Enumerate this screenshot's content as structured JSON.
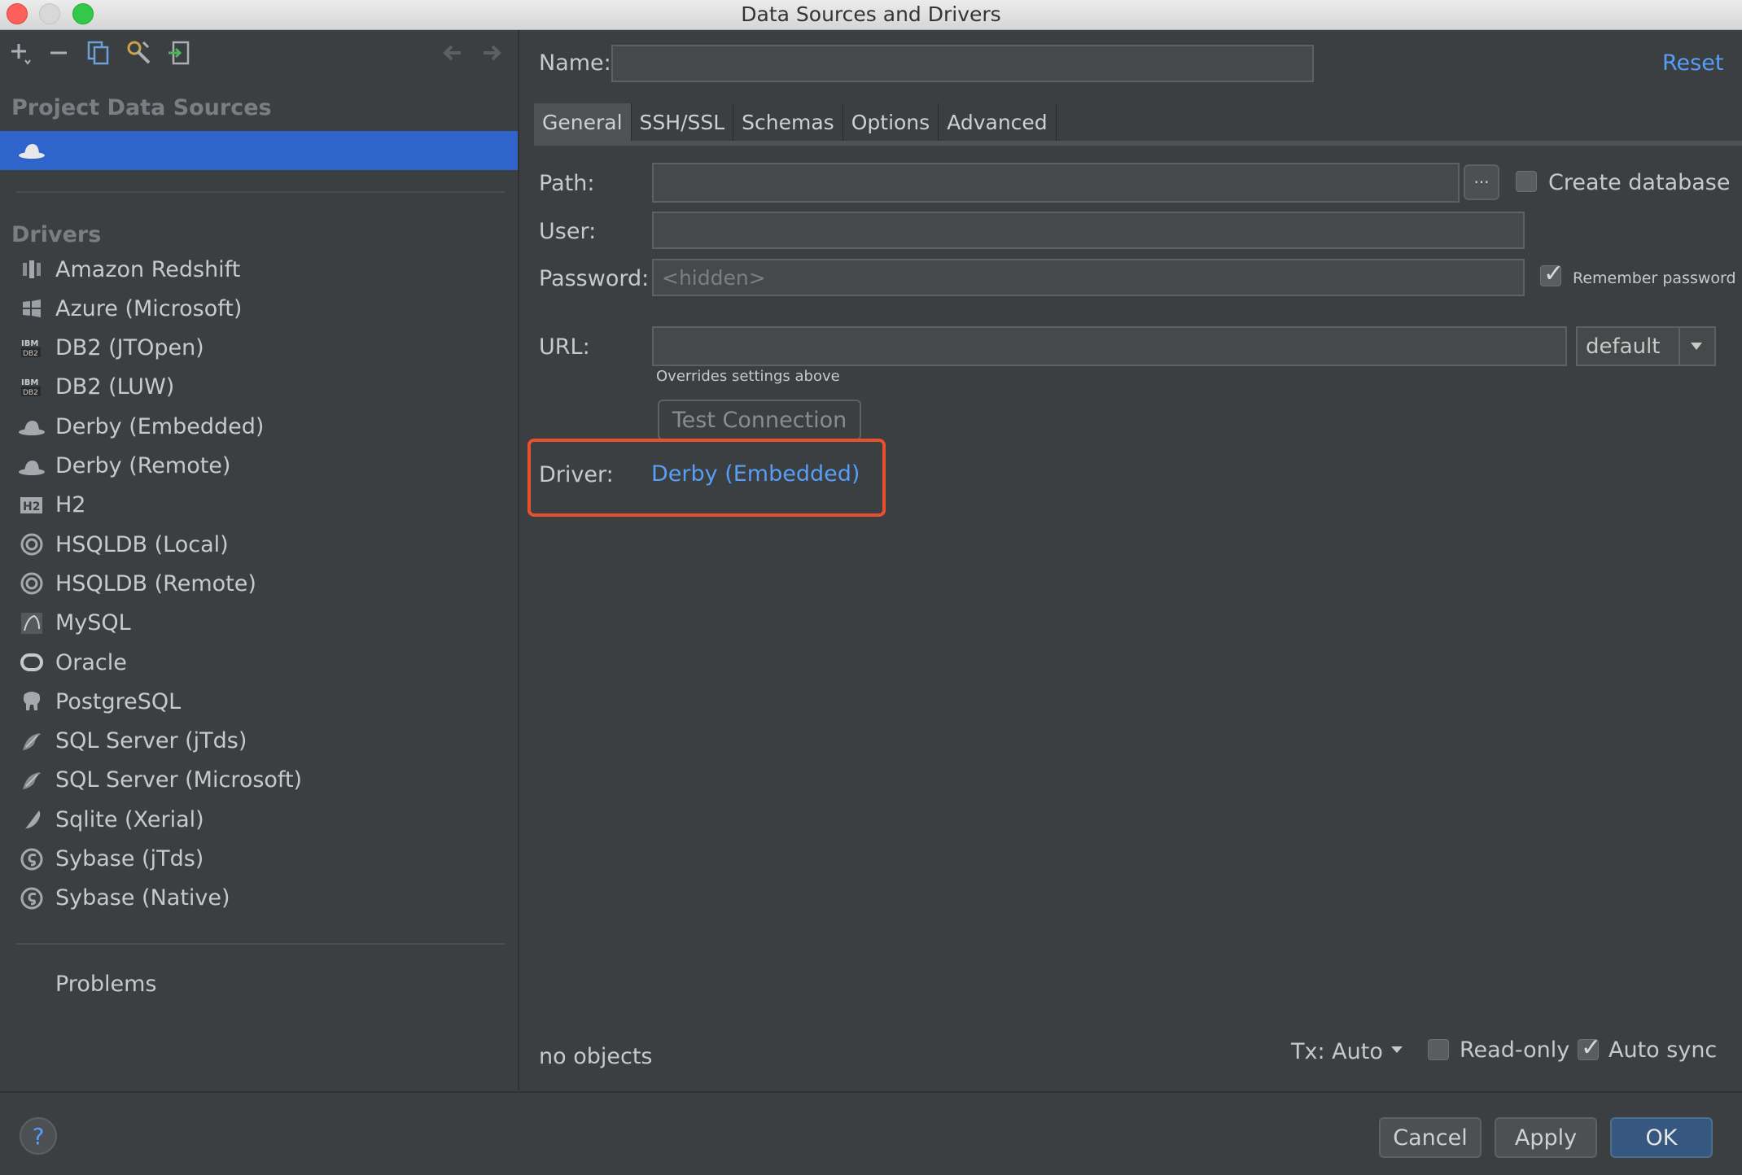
{
  "window": {
    "title": "Data Sources and Drivers"
  },
  "sidebar": {
    "toolbar_icons": [
      "add-icon",
      "remove-icon",
      "duplicate-icon",
      "driver-settings-icon",
      "import-icon",
      "back-arrow-icon",
      "forward-arrow-icon"
    ],
    "project_title": "Project Data Sources",
    "selected_source_icon": "derby-hat-icon",
    "drivers_title": "Drivers",
    "drivers": [
      {
        "label": "Amazon Redshift",
        "icon": "redshift-icon"
      },
      {
        "label": "Azure (Microsoft)",
        "icon": "windows-icon"
      },
      {
        "label": "DB2 (JTOpen)",
        "icon": "ibm-db2-icon"
      },
      {
        "label": "DB2 (LUW)",
        "icon": "ibm-db2-icon"
      },
      {
        "label": "Derby (Embedded)",
        "icon": "derby-hat-icon"
      },
      {
        "label": "Derby (Remote)",
        "icon": "derby-hat-icon"
      },
      {
        "label": "H2",
        "icon": "h2-icon"
      },
      {
        "label": "HSQLDB (Local)",
        "icon": "hsqldb-icon"
      },
      {
        "label": "HSQLDB (Remote)",
        "icon": "hsqldb-icon"
      },
      {
        "label": "MySQL",
        "icon": "mysql-icon"
      },
      {
        "label": "Oracle",
        "icon": "oracle-icon"
      },
      {
        "label": "PostgreSQL",
        "icon": "postgresql-elephant-icon"
      },
      {
        "label": "SQL Server (jTds)",
        "icon": "sqlserver-icon"
      },
      {
        "label": "SQL Server (Microsoft)",
        "icon": "sqlserver-icon"
      },
      {
        "label": "Sqlite (Xerial)",
        "icon": "sqlite-feather-icon"
      },
      {
        "label": "Sybase (jTds)",
        "icon": "sybase-icon"
      },
      {
        "label": "Sybase (Native)",
        "icon": "sybase-icon"
      }
    ],
    "problems_label": "Problems"
  },
  "main": {
    "name_label": "Name:",
    "name_value": "",
    "reset_label": "Reset",
    "tabs": [
      {
        "label": "General",
        "active": true
      },
      {
        "label": "SSH/SSL",
        "active": false
      },
      {
        "label": "Schemas",
        "active": false
      },
      {
        "label": "Options",
        "active": false
      },
      {
        "label": "Advanced",
        "active": false
      }
    ],
    "path_label": "Path:",
    "path_value": "",
    "browse_label": "···",
    "create_db_label": "Create database",
    "create_db_checked": false,
    "user_label": "User:",
    "user_value": "",
    "password_label": "Password:",
    "password_placeholder": "<hidden>",
    "remember_label": "Remember password",
    "remember_checked": true,
    "url_label": "URL:",
    "url_value": "",
    "url_mode": "default",
    "url_hint": "Overrides settings above",
    "test_connection_label": "Test Connection",
    "driver_label": "Driver:",
    "driver_value": "Derby (Embedded)",
    "status_text": "no objects",
    "tx_label": "Tx: Auto",
    "readonly_label": "Read-only",
    "readonly_checked": false,
    "autosync_label": "Auto sync",
    "autosync_checked": true
  },
  "footer": {
    "help_label": "?",
    "cancel_label": "Cancel",
    "apply_label": "Apply",
    "ok_label": "OK"
  },
  "colors": {
    "background": "#3c3f41",
    "selection": "#2f65ca",
    "link": "#589df6",
    "highlight_border": "#e8502f",
    "primary_button": "#365880"
  }
}
